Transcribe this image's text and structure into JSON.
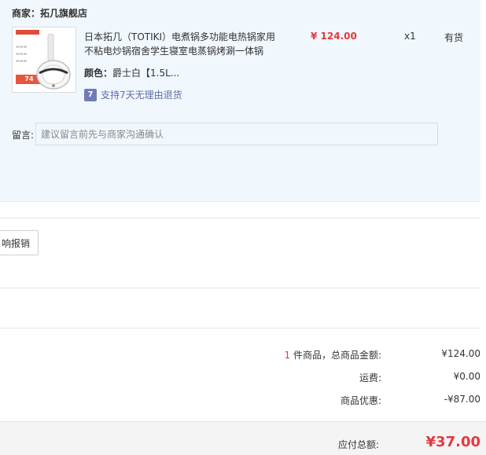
{
  "shop": {
    "title": "商家：拓几旗舰店"
  },
  "product": {
    "thumbnail": {
      "icon": "product-thumbnail",
      "price_tag": "74"
    },
    "name": "日本拓几（TOTIKI）电煮锅多功能电热锅家用不粘电炒锅宿舍学生寝室电蒸锅烤涮一体锅",
    "color_label": "颜色：",
    "color_value": "爵士白【1.5L...",
    "return_policy": "支持7天无理由退货",
    "return_icon": "seven-day-return-icon",
    "price": "¥ 124.00",
    "quantity": "x1",
    "stock": "有货"
  },
  "note": {
    "label": "留言:",
    "placeholder": "建议留言前先与商家沟通确认"
  },
  "invoice": {
    "button_label": "响报销"
  },
  "summary": {
    "item_count": "1",
    "items_label": " 件商品，总商品金额:",
    "items_amount": "¥124.00",
    "shipping_label": "运费:",
    "shipping_amount": "¥0.00",
    "discount_label": "商品优惠:",
    "discount_amount": "-¥87.00"
  },
  "total": {
    "label": "应付总额:",
    "amount": "¥37.00"
  },
  "colors": {
    "accent_red": "#e4393c",
    "panel_bg": "#f0f7fd",
    "return_blue": "#6f7bb8"
  }
}
